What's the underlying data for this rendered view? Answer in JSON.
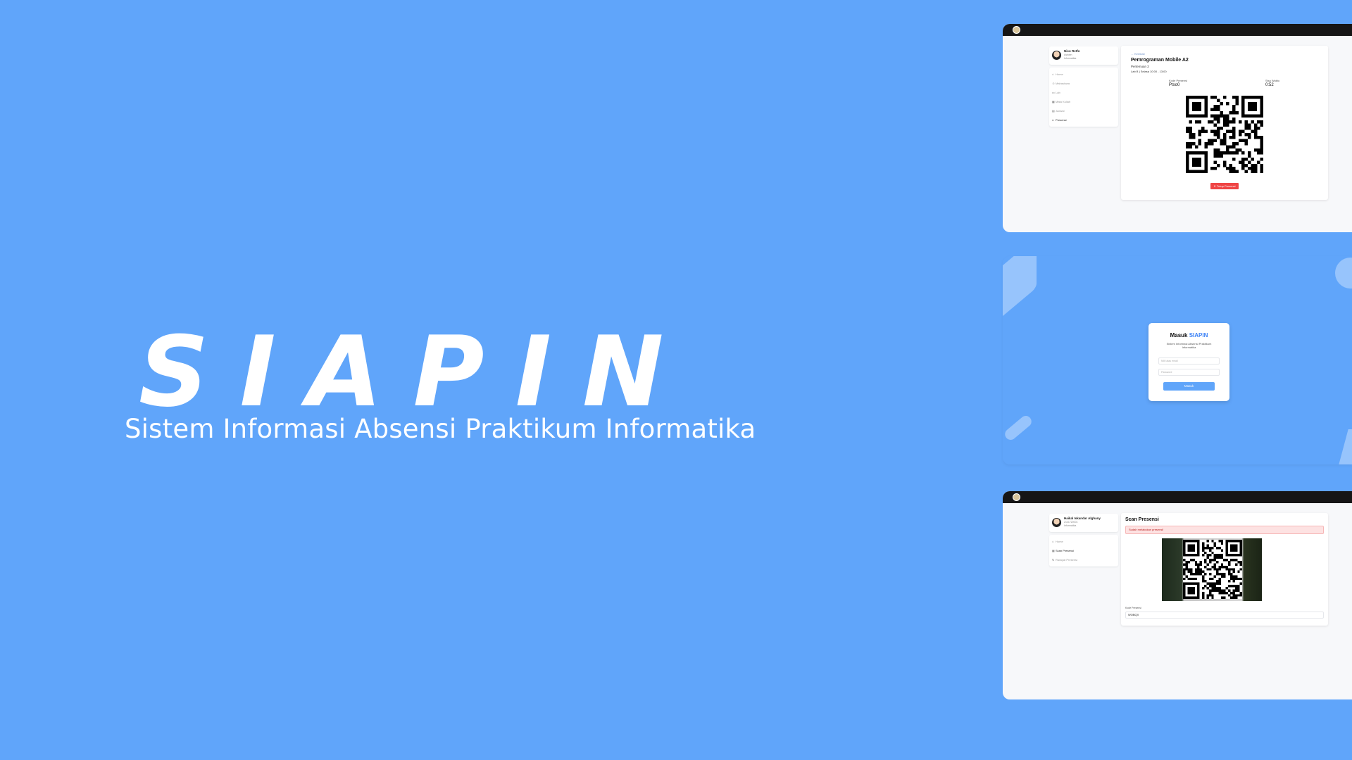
{
  "hero": {
    "title": "SIAPIN",
    "subtitle": "Sistem Informasi Absensi Praktikum Informatika"
  },
  "screen_teacher": {
    "profile": {
      "name": "Nico Retfo",
      "role": "Asisten",
      "dept": "Informatika"
    },
    "menu": [
      {
        "icon": "home-icon",
        "glyph": "⌂",
        "label": "Home",
        "active": false
      },
      {
        "icon": "users-icon",
        "glyph": "☺",
        "label": "Mahasiswa",
        "active": false
      },
      {
        "icon": "lab-icon",
        "glyph": "▭",
        "label": "Lab",
        "active": false
      },
      {
        "icon": "grid-icon",
        "glyph": "▦",
        "label": "Mata Kuliah",
        "active": false
      },
      {
        "icon": "calendar-icon",
        "glyph": "▤",
        "label": "Jadwal",
        "active": false
      },
      {
        "icon": "presensi-icon",
        "glyph": "●",
        "label": "Presensi",
        "active": true
      }
    ],
    "back_label": "← Kembali",
    "course": "Pemrograman Mobile A2",
    "meeting": "Pertemuan 2",
    "room_time": "Lab B | Selasa 10:00 - 13:00",
    "code_label": "Kode Presensi",
    "code_value": "Ptso0",
    "time_label": "Sisa Waktu",
    "time_value": "0:52",
    "close_button": "✕ Tutup Presensi"
  },
  "screen_login": {
    "title_prefix": "Masuk ",
    "title_accent": "SIAPIN",
    "description": "Sistem Informasi Absensi Praktikum Informatika",
    "email_placeholder": "NIM atau email",
    "password_placeholder": "Password",
    "submit": "Masuk"
  },
  "screen_student": {
    "profile": {
      "name": "Haikal Iskandar Alghany",
      "nim": "2141720001",
      "dept": "Informatika"
    },
    "menu": [
      {
        "icon": "home-icon",
        "glyph": "⌂",
        "label": "Home",
        "active": false
      },
      {
        "icon": "qr-icon",
        "glyph": "▦",
        "label": "Scan Presensi",
        "active": true
      },
      {
        "icon": "history-icon",
        "glyph": "↻",
        "label": "Riwayat Presensi",
        "active": false
      }
    ],
    "title": "Scan Presensi",
    "alert": "Sudah melakukan presensi!",
    "code_label": "Kode Presensi",
    "code_value": "WOBQX"
  },
  "colors": {
    "background": "#60a5fa",
    "accent": "#3b82f6",
    "danger": "#ef4444",
    "topbar": "#161616"
  }
}
